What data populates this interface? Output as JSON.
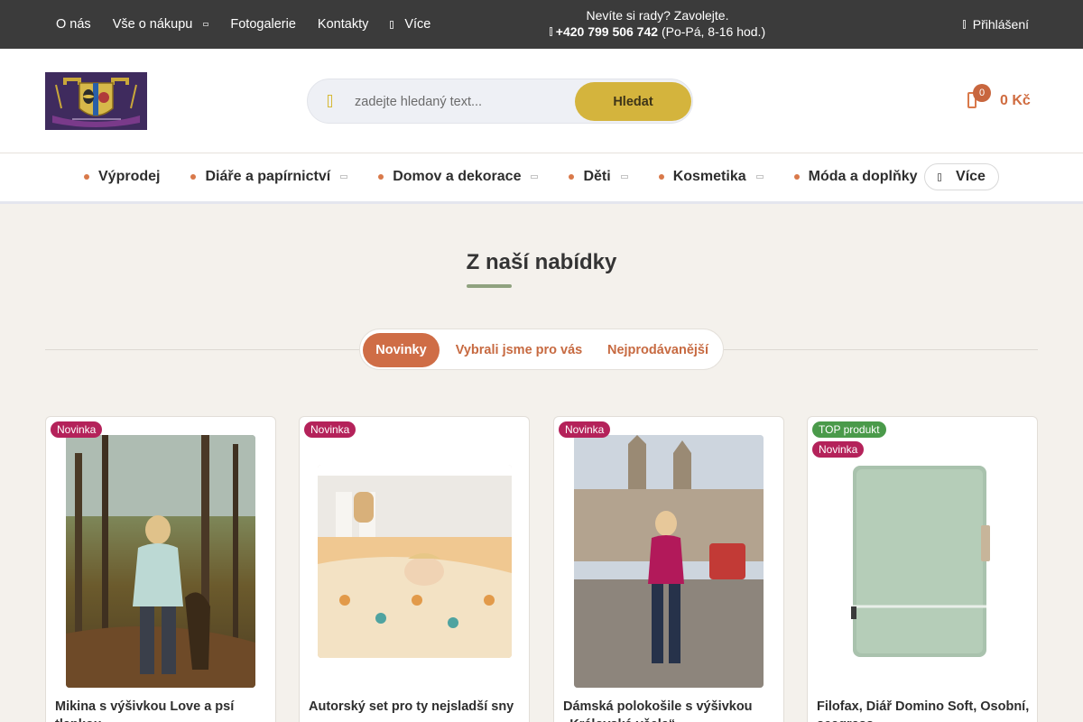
{
  "topbar": {
    "nav": [
      {
        "label": "O nás",
        "caret": false
      },
      {
        "label": "Vše o nákupu",
        "caret": true
      },
      {
        "label": "Fotogalerie",
        "caret": false
      },
      {
        "label": "Kontakty",
        "caret": false
      }
    ],
    "more_label": "Více",
    "contact_line1": "Nevíte si rady? Zavolejte.",
    "phone": "+420 799 506 742",
    "hours": "(Po-Pá, 8-16 hod.)",
    "login_label": "Přihlášení"
  },
  "header": {
    "search_placeholder": "zadejte hledaný text...",
    "search_button": "Hledat",
    "cart_count": "0",
    "cart_total": "0 Kč"
  },
  "categories": {
    "items": [
      {
        "label": "Výprodej"
      },
      {
        "label": "Diáře a papírnictví"
      },
      {
        "label": "Domov a dekorace"
      },
      {
        "label": "Děti"
      },
      {
        "label": "Kosmetika"
      },
      {
        "label": "Móda a doplňky"
      }
    ],
    "more_label": "Více"
  },
  "section": {
    "title": "Z naší nabídky",
    "tabs": [
      "Novinky",
      "Vybrali jsme pro vás",
      "Nejprodávanější"
    ],
    "active_tab": "Novinky"
  },
  "products": [
    {
      "name": "Mikina s výšivkou Love a psí tlapkou",
      "tags": [
        "Novinka"
      ]
    },
    {
      "name": "Autorský set pro ty nejsladší sny",
      "tags": [
        "Novinka"
      ]
    },
    {
      "name": "Dámská polokošile s výšivkou „Královská včela“",
      "tags": [
        "Novinka"
      ]
    },
    {
      "name": "Filofax, Diář Domino Soft, Osobní, seagrass",
      "tags": [
        "TOP produkt",
        "Novinka"
      ]
    }
  ],
  "colors": {
    "accent": "#cf6d46",
    "search_button": "#d4b43d",
    "tag_new": "#b4225a",
    "tag_top": "#4a9a4a"
  }
}
